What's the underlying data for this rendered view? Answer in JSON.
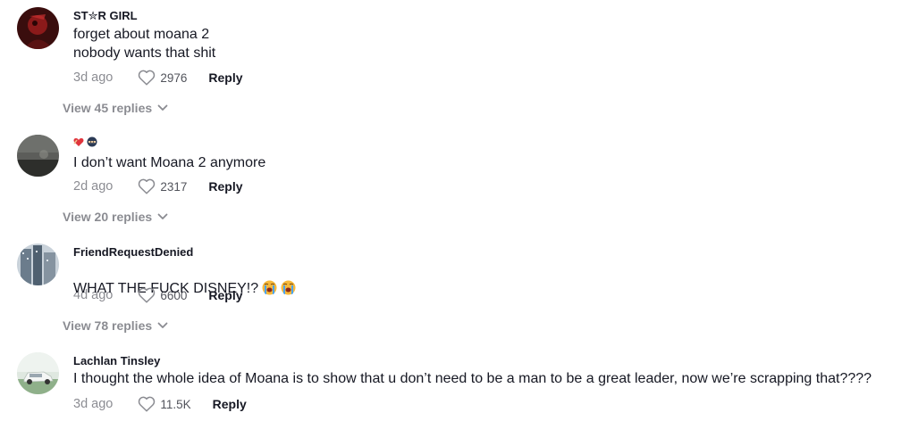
{
  "colors": {
    "text": "#161823",
    "muted": "#8a8b91",
    "avatar1": "#5a1212",
    "avatar2": "#4a4a48",
    "avatar3": "#7a8a9a",
    "avatar4": "#9ab0a0"
  },
  "comments": [
    {
      "username": "ST✮R GIRL",
      "text": "forget about moana 2\nnobody wants that shit",
      "date": "3d ago",
      "likes": "2976",
      "reply_label": "Reply",
      "view_replies": "View 45 replies"
    },
    {
      "username": "",
      "username_emojis": [
        "red-heart-hands-emoji",
        "ninja-emoji"
      ],
      "text": "I don’t want Moana 2 anymore",
      "date": "2d ago",
      "likes": "2317",
      "reply_label": "Reply",
      "view_replies": "View 20 replies"
    },
    {
      "username": "FriendRequestDenied",
      "text": "WHAT THE FUCK DISNEY!?",
      "text_emojis": [
        "crying-face-emoji",
        "crying-face-emoji"
      ],
      "date": "4d ago",
      "likes": "6600",
      "reply_label": "Reply",
      "view_replies": "View 78 replies"
    },
    {
      "username": "Lachlan Tinsley",
      "text": "I thought the whole idea of Moana is to show that u don’t need to be a man to be a great leader, now we’re scrapping that????",
      "date": "3d ago",
      "likes": "11.5K",
      "reply_label": "Reply"
    }
  ]
}
